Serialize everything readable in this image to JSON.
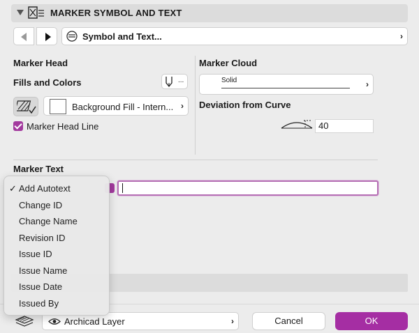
{
  "panel": {
    "title": "MARKER SYMBOL AND TEXT"
  },
  "navigation": {
    "current_page": "Symbol and Text...",
    "chevron": "›"
  },
  "marker_head": {
    "section_label": "Marker Head",
    "fills_label": "Fills and Colors",
    "pen_button_text": "...",
    "background_fill_label": "Background Fill - Intern...",
    "head_line_label": "Marker Head Line",
    "head_line_checked": true
  },
  "marker_cloud": {
    "section_label": "Marker Cloud",
    "line_type": "Solid",
    "deviation_label": "Deviation from Curve",
    "deviation_value": "40"
  },
  "marker_text": {
    "section_label": "Marker Text",
    "value": ""
  },
  "autotext_menu": {
    "check_glyph": "✓",
    "items": [
      "Add Autotext",
      "Change ID",
      "Change Name",
      "Revision ID",
      "Issue ID",
      "Issue Name",
      "Issue Date",
      "Issued By"
    ]
  },
  "footer": {
    "layer_label": "Archicad Layer",
    "cancel_label": "Cancel",
    "ok_label": "OK"
  },
  "colors": {
    "accent": "#a52ea3",
    "panel_bg": "#ececec",
    "header_bg": "#dcdcdc"
  },
  "icons": [
    "disclosure-triangle-icon",
    "marker-symbol-icon",
    "back-arrow-icon",
    "forward-arrow-icon",
    "page-list-icon",
    "pen-icon",
    "fill-pattern-icon",
    "cloud-curve-icon",
    "layer-stack-icon",
    "eye-icon"
  ]
}
